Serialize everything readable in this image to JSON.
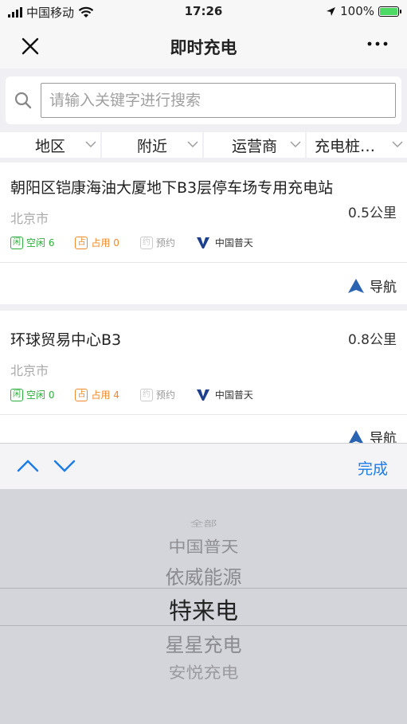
{
  "status_bar": {
    "carrier": "中国移动",
    "time": "17:26",
    "battery": "100%"
  },
  "navbar": {
    "close_label": "×",
    "title": "即时充电",
    "more_label": "···"
  },
  "search": {
    "placeholder": "请输入关键字进行搜索",
    "value": ""
  },
  "filters": [
    {
      "label": "地区"
    },
    {
      "label": "附近"
    },
    {
      "label": "运营商"
    },
    {
      "label": "充电桩…"
    }
  ],
  "stations": [
    {
      "name": "朝阳区铠康海油大厦地下B3层停车场专用充电站",
      "city": "北京市",
      "distance": "0.5公里",
      "free_icon": "闲",
      "free_label": "空闲 6",
      "busy_icon": "占",
      "busy_label": "占用 0",
      "reserve_icon": "约",
      "reserve_label": "预约",
      "brand": "中国普天",
      "nav_label": "导航"
    },
    {
      "name": "环球贸易中心B3",
      "city": "北京市",
      "distance": "0.8公里",
      "free_icon": "闲",
      "free_label": "空闲 0",
      "busy_icon": "占",
      "busy_label": "占用 4",
      "reserve_icon": "约",
      "reserve_label": "预约",
      "brand": "中国普天",
      "nav_label": "导航"
    }
  ],
  "picker_toolbar": {
    "done_label": "完成"
  },
  "picker": {
    "options": [
      "全部",
      "中国普天",
      "依威能源",
      "特来电",
      "星星充电",
      "安悦充电"
    ],
    "selected": "特来电"
  },
  "colors": {
    "free": "#2fae3f",
    "busy": "#f08a2c",
    "accent": "#1a7ce8",
    "nav_arrow": "#2a64b0"
  }
}
